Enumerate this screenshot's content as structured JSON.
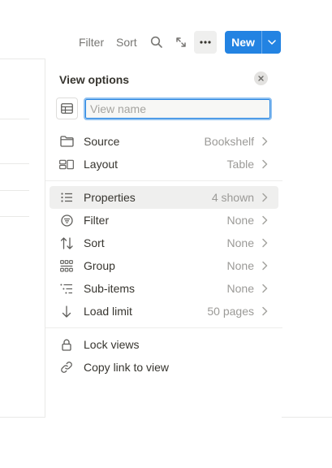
{
  "toolbar": {
    "filter_label": "Filter",
    "sort_label": "Sort",
    "new_label": "New",
    "icons": [
      "search-icon",
      "expand-icon",
      "more-icon",
      "chevron-down-icon"
    ],
    "accent": "#2383e2"
  },
  "panel": {
    "title": "View options",
    "name_placeholder": "View name",
    "name_value": "",
    "section1": [
      {
        "label": "Source",
        "value": "Bookshelf",
        "icon": "folder-icon"
      },
      {
        "label": "Layout",
        "value": "Table",
        "icon": "layout-icon"
      }
    ],
    "section2": [
      {
        "label": "Properties",
        "value": "4 shown",
        "icon": "list-icon"
      },
      {
        "label": "Filter",
        "value": "None",
        "icon": "filter-icon"
      },
      {
        "label": "Sort",
        "value": "None",
        "icon": "sort-icon"
      },
      {
        "label": "Group",
        "value": "None",
        "icon": "group-icon"
      },
      {
        "label": "Sub-items",
        "value": "None",
        "icon": "sub-items-icon"
      },
      {
        "label": "Load limit",
        "value": "50 pages",
        "icon": "arrow-down-icon"
      }
    ],
    "section3": [
      {
        "label": "Lock views",
        "icon": "lock-icon"
      },
      {
        "label": "Copy link to view",
        "icon": "link-icon"
      }
    ]
  }
}
